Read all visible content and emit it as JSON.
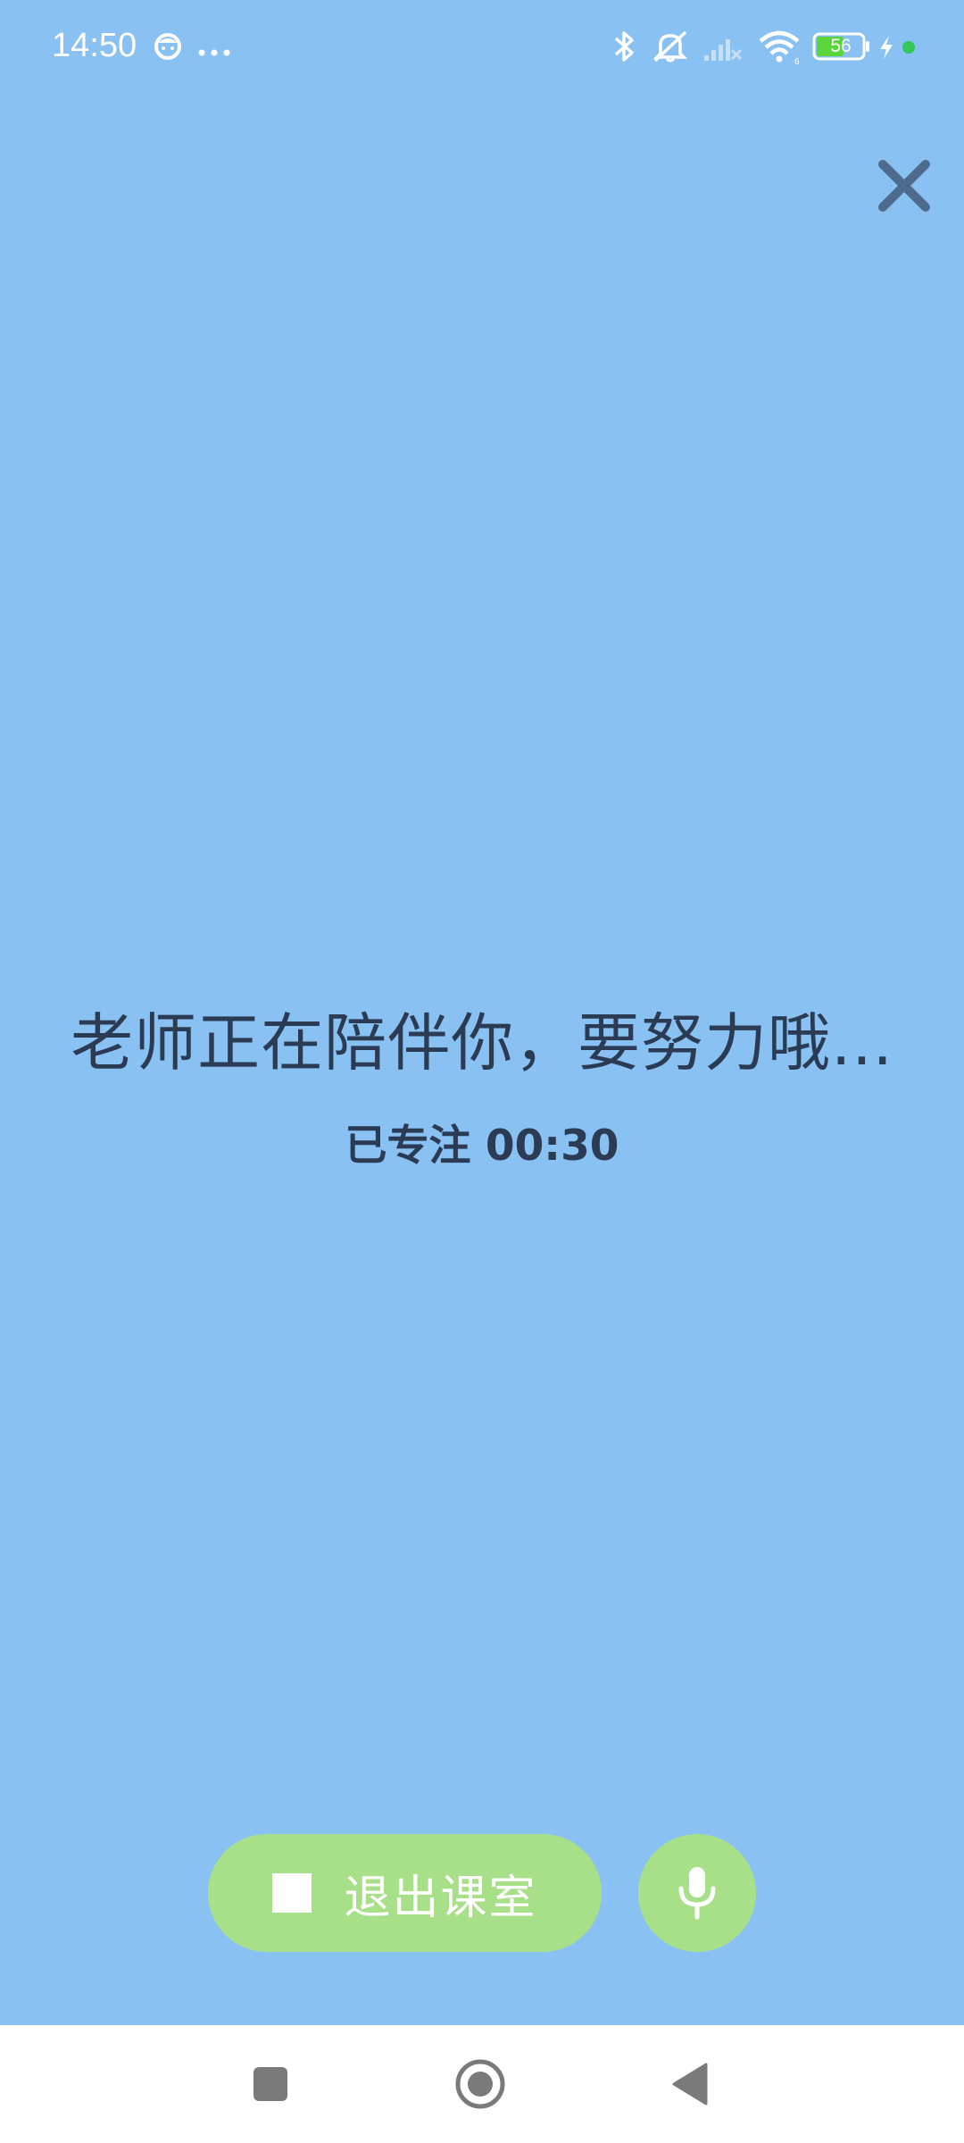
{
  "status_bar": {
    "time": "14:50",
    "battery_level": "56",
    "icons": [
      "face-icon",
      "more-dots-icon",
      "bluetooth-icon",
      "mute-icon",
      "signal-icon",
      "wifi-icon",
      "battery-icon",
      "charging-icon",
      "privacy-dot-icon"
    ]
  },
  "main": {
    "message": "老师正在陪伴你，要努力哦...",
    "timer_label": "已专注 00:30"
  },
  "controls": {
    "exit_label": "退出课室"
  },
  "colors": {
    "background": "#89c1f3",
    "button": "#a8df89",
    "text": "#2b3b54",
    "close_icon": "#4d6c8c",
    "battery_fill": "#5ad53a",
    "privacy_dot": "#34c759"
  }
}
